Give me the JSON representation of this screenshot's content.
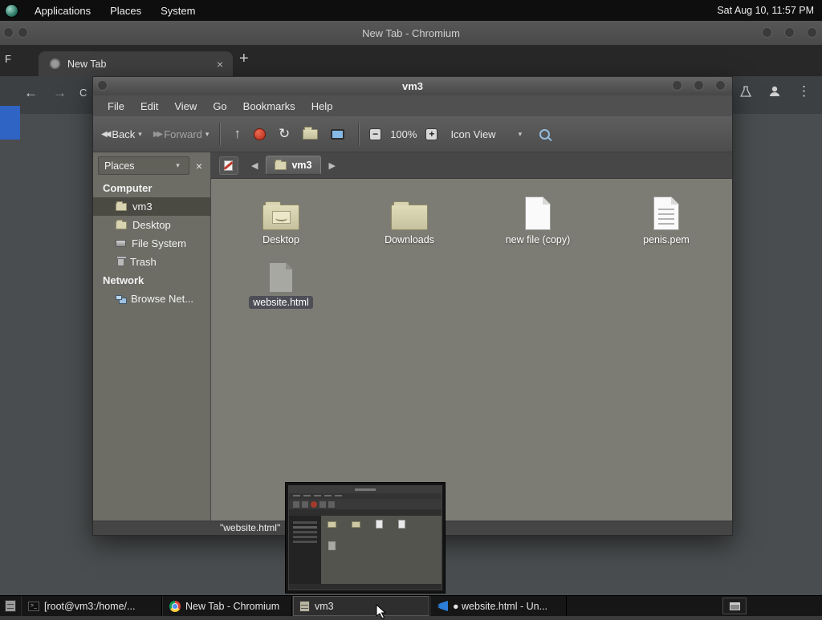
{
  "glyphs": {
    "caret": "▾",
    "close": "×",
    "plus": "+",
    "back_arrow": "←",
    "forward_arrow": "→",
    "menu_dots": "⋮",
    "up_arrow": "↑",
    "refresh": "↻",
    "chev_left": "◀",
    "chev_right": "▶",
    "back_double": "◀◀",
    "fwd_double": "▶▶",
    "minus": "−"
  },
  "panel": {
    "menus": [
      "Applications",
      "Places",
      "System"
    ],
    "clock": "Sat Aug 10, 11:57 PM"
  },
  "chromium": {
    "title": "New Tab - Chromium",
    "tab_label": "New Tab",
    "partial_text_f": "F",
    "partial_url": "C"
  },
  "fm": {
    "title": "vm3",
    "menus": [
      "File",
      "Edit",
      "View",
      "Go",
      "Bookmarks",
      "Help"
    ],
    "toolbar": {
      "back": "Back",
      "forward": "Forward",
      "zoom_level": "100%",
      "view_mode": "Icon View"
    },
    "location": {
      "folder_button": "vm3"
    },
    "sidebar": {
      "header": "Places",
      "items": [
        {
          "label": "Computer"
        },
        {
          "label": "vm3"
        },
        {
          "label": "Desktop"
        },
        {
          "label": "File System"
        },
        {
          "label": "Trash"
        },
        {
          "label": "Network"
        },
        {
          "label": "Browse Net..."
        }
      ]
    },
    "files": [
      {
        "name": "Desktop"
      },
      {
        "name": "Downloads"
      },
      {
        "name": "new file (copy)"
      },
      {
        "name": "penis.pem"
      },
      {
        "name": "website.html"
      }
    ],
    "status": "\"website.html\""
  },
  "taskbar": {
    "items": [
      {
        "label": "[root@vm3:/home/..."
      },
      {
        "label": "New Tab - Chromium"
      },
      {
        "label": "vm3"
      },
      {
        "label": "● website.html - Un..."
      }
    ]
  }
}
